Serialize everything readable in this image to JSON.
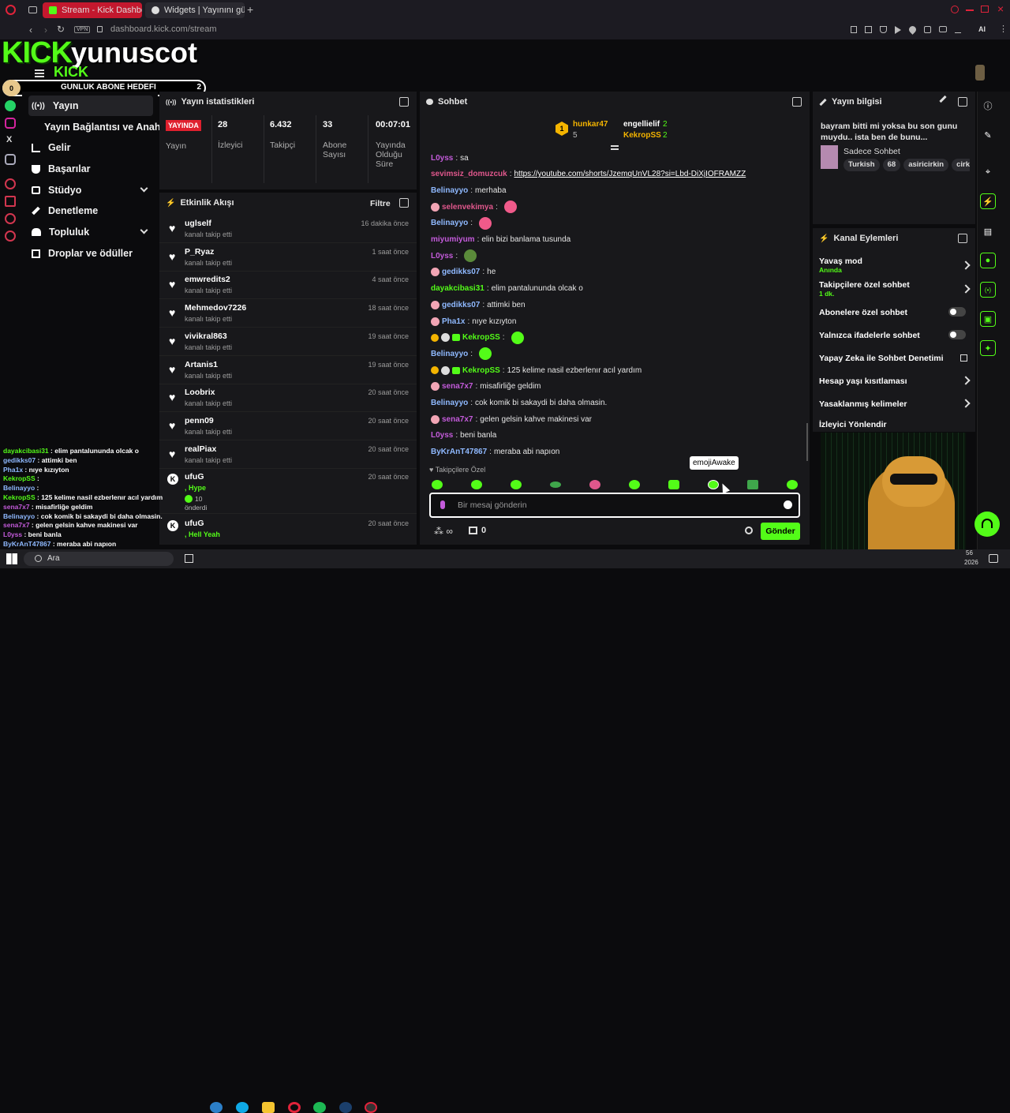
{
  "browser": {
    "tabs": [
      {
        "label": "Stream - Kick Dashboard"
      },
      {
        "label": "Widgets | Yayınını güçlend"
      }
    ],
    "vpn": "VPN",
    "url": "dashboard.kick.com/stream",
    "ai_label": "AI"
  },
  "overlay": {
    "channel_name": "yunuscot",
    "kick_logo": "KICK",
    "goal_current": "0",
    "goal_label": "GUNLUK ABONE HEDEFI",
    "goal_target": "2"
  },
  "nav": {
    "items": [
      {
        "label": "Yayın",
        "icon": "broadcast-icon"
      },
      {
        "label": "Yayın Bağlantısı ve Anahtarı"
      },
      {
        "label": "Gelir",
        "icon": "chart-icon"
      },
      {
        "label": "Başarılar",
        "icon": "trophy-icon"
      },
      {
        "label": "Stüdyo",
        "icon": "studio-icon"
      },
      {
        "label": "Denetleme",
        "icon": "wrench-icon"
      },
      {
        "label": "Topluluk",
        "icon": "people-icon"
      },
      {
        "label": "Droplar ve ödüller",
        "icon": "gift-icon"
      }
    ]
  },
  "stats": {
    "title": "Yayın istatistikleri",
    "live_badge": "YAYINDA",
    "items": [
      {
        "value": "28",
        "label": "İzleyici"
      },
      {
        "value": "6.432",
        "label": "Takipçi"
      },
      {
        "value": "33",
        "label": "Abone Sayısı"
      },
      {
        "value": "00:07:01",
        "label": "Yayında Olduğu Süre"
      }
    ],
    "broadcast_label": "Yayın"
  },
  "activity": {
    "title": "Etkinlik Akışı",
    "filter": "Filtre",
    "events": [
      {
        "name": "uglself",
        "action": "kanalı takip etti",
        "time": "16 dakika önce"
      },
      {
        "name": "P_Ryaz",
        "action": "kanalı takip etti",
        "time": "1 saat önce"
      },
      {
        "name": "emwredits2",
        "action": "kanalı takip etti",
        "time": "4 saat önce"
      },
      {
        "name": "Mehmedov7226",
        "action": "kanalı takip etti",
        "time": "18 saat önce"
      },
      {
        "name": "vivikral863",
        "action": "kanalı takip etti",
        "time": "19 saat önce"
      },
      {
        "name": "Artanis1",
        "action": "kanalı takip etti",
        "time": "19 saat önce"
      },
      {
        "name": "Loobrix",
        "action": "kanalı takip etti",
        "time": "20 saat önce"
      },
      {
        "name": "penn09",
        "action": "kanalı takip etti",
        "time": "20 saat önce"
      },
      {
        "name": "realPiax",
        "action": "kanalı takip etti",
        "time": "20 saat önce"
      }
    ],
    "kick_events": [
      {
        "name": "ufuG",
        "msg": ", Hype",
        "amount": "10",
        "verb": "önderdi",
        "time": "20 saat önce"
      },
      {
        "name": "ufuG",
        "msg": ", Hell Yeah",
        "time": "20 saat önce"
      }
    ]
  },
  "chat": {
    "title": "Sohbet",
    "pinned": {
      "gifter_rank": "1",
      "gifter_name": "hunkar47",
      "gifter_count": "5",
      "leaders": [
        {
          "name": "engellielif",
          "count": "2"
        },
        {
          "name": "KekropSS",
          "count": "2"
        }
      ]
    },
    "messages": [
      {
        "user": "L0yss",
        "color": "#c45bdb",
        "text": "sa"
      },
      {
        "user": "sevimsiz_domuzcuk",
        "color": "#e0578c",
        "text": "https://youtube.com/shorts/JzemqUnVL28?si=Lbd-DiXjIOFRAMZZ",
        "link": true
      },
      {
        "user": "Belinayyo",
        "color": "#8fb9ff",
        "text": "merhaba"
      },
      {
        "user": "selenvekimya",
        "color": "#e0578c",
        "text": "",
        "pig": true,
        "emote": "pink"
      },
      {
        "user": "Belinayyo",
        "color": "#8fb9ff",
        "text": "",
        "emote": "pink"
      },
      {
        "user": "miyumiyum",
        "color": "#c45bdb",
        "text": "elin bizi banlama tusunda"
      },
      {
        "user": "L0yss",
        "color": "#c45bdb",
        "text": "",
        "emote": "frog"
      },
      {
        "user": "gedikks07",
        "color": "#8fb9ff",
        "text": "he",
        "pig": true
      },
      {
        "user": "dayakcibasi31",
        "color": "#53fc18",
        "text": "elim pantalunundа olcak o"
      },
      {
        "user": "gedikks07",
        "color": "#8fb9ff",
        "text": "attimki ben",
        "pig": true
      },
      {
        "user": "Pha1x",
        "color": "#8fb9ff",
        "text": "nıye kızıyton",
        "pig": true
      },
      {
        "user": "KekropSS",
        "color": "#53fc18",
        "text": "",
        "badges": true,
        "emote": "green"
      },
      {
        "user": "Belinayyo",
        "color": "#8fb9ff",
        "text": "",
        "emote": "green"
      },
      {
        "user": "KekropSS",
        "color": "#53fc18",
        "text": "125 kelime nasil ezberlenır acıl yardım",
        "badges": true
      },
      {
        "user": "sena7x7",
        "color": "#c45bdb",
        "text": "misafirliğe geldim",
        "pig": true
      },
      {
        "user": "Belinayyo",
        "color": "#8fb9ff",
        "text": "cok komik bi sakaydi bi daha olmasin."
      },
      {
        "user": "sena7x7",
        "color": "#c45bdb",
        "text": "gelen gelsin kahve makinesi var",
        "pig": true
      },
      {
        "user": "L0yss",
        "color": "#c45bdb",
        "text": "beni banla"
      },
      {
        "user": "ByKrAnT47867",
        "color": "#8fb9ff",
        "text": "meraba abi napıon"
      }
    ],
    "followers_only_label": "Takipçilere Özel",
    "emote_tooltip": "emojiAwake",
    "input_placeholder": "Bir mesaj gönderin",
    "points": "0",
    "send_label": "Gönder"
  },
  "stream_info": {
    "title": "Yayın bilgisi",
    "stream_title": "bayram bitti mi yoksa bu son gunu muydu.. ista ben de bunu...",
    "category": "Sadece Sohbet",
    "tags": [
      "Turkish",
      "68",
      "asiricirkin",
      "cirk"
    ]
  },
  "channel_actions": {
    "title": "Kanal Eylemleri",
    "items": [
      {
        "label": "Yavaş mod",
        "sub": "Anında"
      },
      {
        "label": "Takipçilere özel sohbet",
        "sub": "1 dk."
      },
      {
        "label": "Abonelere özel sohbet"
      },
      {
        "label": "Yalnızca ifadelerle sohbet"
      },
      {
        "label": "Yapay Zeka ile Sohbet Denetimi"
      },
      {
        "label": "Hesap yaşı kısıtlaması"
      },
      {
        "label": "Yasaklanmış kelimeler"
      },
      {
        "label": "İzleyici Yönlendir"
      }
    ]
  },
  "overlay_chat": [
    {
      "user": "dayakcibasi31",
      "color": "#53fc18",
      "text": "elim pantalunundа olcak o"
    },
    {
      "user": "gedikks07",
      "color": "#8fb9ff",
      "text": "attimki ben"
    },
    {
      "user": "Pha1x",
      "color": "#8fb9ff",
      "text": "nıye kızıyton"
    },
    {
      "user": "KekropSS",
      "color": "#53fc18",
      "text": ""
    },
    {
      "user": "Belinayyo",
      "color": "#8fb9ff",
      "text": ""
    },
    {
      "user": "KekropSS",
      "color": "#53fc18",
      "text": "125 kelime nasil ezberlenır acıl yardım"
    },
    {
      "user": "sena7x7",
      "color": "#c45bdb",
      "text": "misafirliğe geldim"
    },
    {
      "user": "Belinayyo",
      "color": "#8fb9ff",
      "text": "cok komik bi sakaydi bi daha olmasin."
    },
    {
      "user": "sena7x7",
      "color": "#c45bdb",
      "text": "gelen gelsin kahve makinesi var"
    },
    {
      "user": "L0yss",
      "color": "#c45bdb",
      "text": "beni banla"
    },
    {
      "user": "ByKrAnT47867",
      "color": "#8fb9ff",
      "text": "meraba abi napıon"
    }
  ],
  "taskbar": {
    "search": "Ara",
    "clock_time": "56",
    "clock_year": "2026"
  },
  "colors": {
    "kick_green": "#53fc18",
    "live_red": "#e0202e",
    "panel": "#18181b",
    "background": "#0b0b0d"
  }
}
